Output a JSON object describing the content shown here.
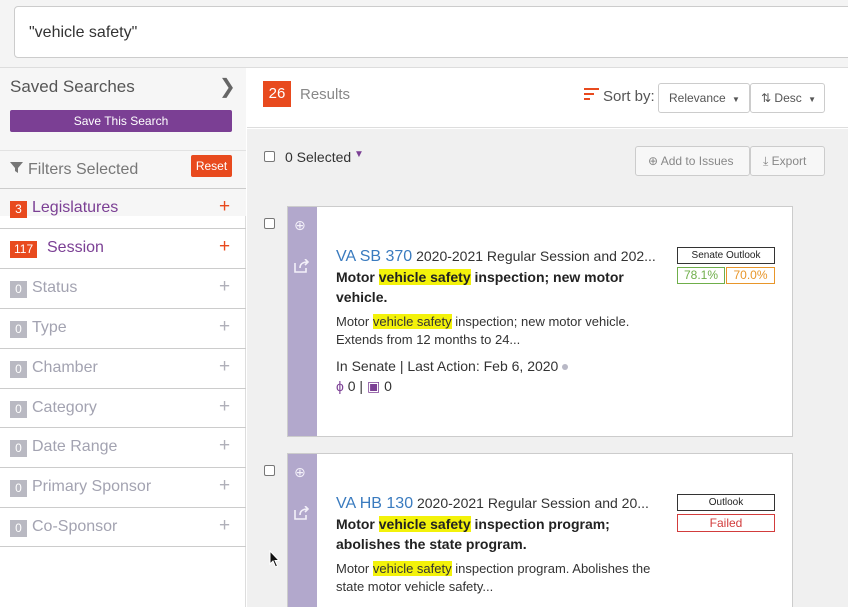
{
  "search": {
    "query": "\"vehicle safety\""
  },
  "sidebar": {
    "saved_title": "Saved Searches",
    "save_button": "Save This Search",
    "filters_title": "Filters Selected",
    "reset_button": "Reset",
    "filters": [
      {
        "count": "3",
        "label": "Legislatures",
        "active": true
      },
      {
        "count": "117",
        "label": "Session",
        "active": true
      },
      {
        "count": "0",
        "label": "Status",
        "active": false
      },
      {
        "count": "0",
        "label": "Type",
        "active": false
      },
      {
        "count": "0",
        "label": "Chamber",
        "active": false
      },
      {
        "count": "0",
        "label": "Category",
        "active": false
      },
      {
        "count": "0",
        "label": "Date Range",
        "active": false
      },
      {
        "count": "0",
        "label": "Primary Sponsor",
        "active": false
      },
      {
        "count": "0",
        "label": "Co-Sponsor",
        "active": false
      }
    ]
  },
  "results": {
    "count": "26",
    "label": "Results",
    "sort_label": "Sort by:",
    "sort_field": "Relevance",
    "sort_order": "Desc",
    "selected_label": "0 Selected",
    "add_to_issues": "Add to Issues",
    "export": "Export"
  },
  "bills": [
    {
      "id": "VA SB 370",
      "session": "2020-2021 Regular Session and 202...",
      "desc_pre": "Motor ",
      "desc_hl": "vehicle safety",
      "desc_post": " inspection; new motor vehicle.",
      "summary_pre": "Motor ",
      "summary_hl": "vehicle safety",
      "summary_post": " inspection; new motor vehicle. Extends from 12 months to 24...",
      "status": "In Senate | Last Action: Feb 6, 2020",
      "actions_count": "0",
      "notes_count": "0",
      "outlook_label": "Senate Outlook",
      "pct_1": "78.1%",
      "pct_2": "70.0%"
    },
    {
      "id": "VA HB 130",
      "session": "2020-2021 Regular Session and 20...",
      "desc_pre": "Motor ",
      "desc_hl": "vehicle safety",
      "desc_post": " inspection program; abolishes the state program.",
      "summary_pre": "Motor ",
      "summary_hl": "vehicle safety",
      "summary_post": " inspection program. Abolishes the state motor vehicle safety...",
      "outlook_label": "Outlook",
      "outlook_result": "Failed"
    }
  ],
  "colors": {
    "accent": "#e84a1e",
    "brand": "#7b3f94",
    "rail": "#b2a8cc",
    "highlight": "#f3f20a"
  },
  "icons": [
    "chevron-right-icon",
    "filter-icon",
    "plus-icon",
    "sort-icon",
    "caret-down-icon",
    "plus-circle-icon",
    "download-icon",
    "share-icon",
    "bolt-icon",
    "note-icon",
    "mouse-cursor-icon"
  ]
}
